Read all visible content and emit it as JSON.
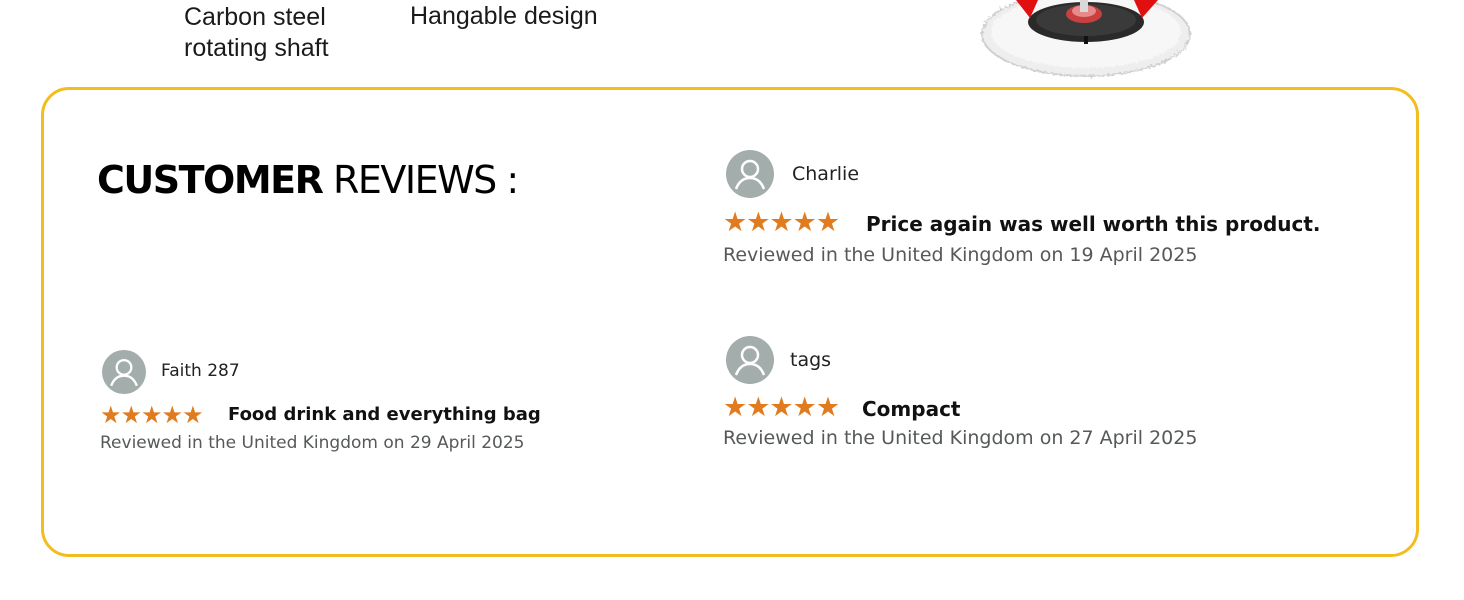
{
  "features": {
    "shaft_label": "Carbon steel\nrotating shaft",
    "hang_label": "Hangable design"
  },
  "reviews_section": {
    "title_heavy": "CUSTOMER",
    "title_light": "REVIEWS :",
    "accent_color": "#f3bd1f",
    "star_color": "#e07b1f",
    "reviews": [
      {
        "name": "Charlie",
        "stars": "★★★★★",
        "rating": 5,
        "title": "Price again was well worth this product.",
        "meta": "Reviewed in the United Kingdom on 19 April 2025",
        "avatar_icon": "user-avatar-icon"
      },
      {
        "name": "Faith 287",
        "stars": "★★★★★",
        "rating": 5,
        "title": "Food drink and everything bag",
        "meta": "Reviewed in the United Kingdom on 29 April 2025",
        "avatar_icon": "user-avatar-icon"
      },
      {
        "name": "tags",
        "stars": "★★★★★",
        "rating": 5,
        "title": "Compact",
        "meta": "Reviewed in the United Kingdom on 27 April 2025",
        "avatar_icon": "user-avatar-icon"
      }
    ]
  }
}
